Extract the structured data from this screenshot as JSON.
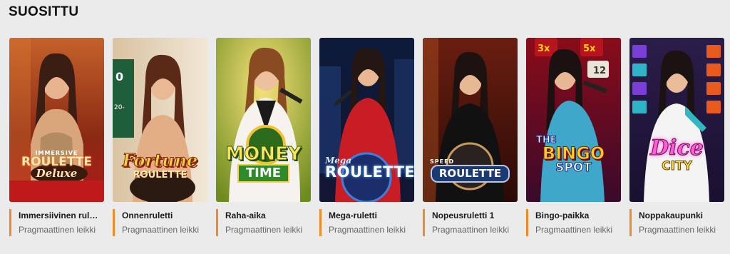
{
  "section": {
    "title": "SUOSITTU"
  },
  "games": [
    {
      "title": "Immersiivinen rul…",
      "provider": "Pragmaattinen leikki",
      "logo_lines": [
        "IMMERSIVE",
        "ROULETTE",
        "Deluxe"
      ]
    },
    {
      "title": "Onnenruletti",
      "provider": "Pragmaattinen leikki",
      "logo_lines": [
        "Fortune",
        "ROULETTE"
      ]
    },
    {
      "title": "Raha-aika",
      "provider": "Pragmaattinen leikki",
      "logo_lines": [
        "MONEY",
        "TIME"
      ]
    },
    {
      "title": "Mega-ruletti",
      "provider": "Pragmaattinen leikki",
      "logo_lines": [
        "Mega",
        "ROULETTE"
      ]
    },
    {
      "title": "Nopeusruletti 1",
      "provider": "Pragmaattinen leikki",
      "logo_lines": [
        "SPEED",
        "ROULETTE"
      ]
    },
    {
      "title": "Bingo-paikka",
      "provider": "Pragmaattinen leikki",
      "logo_lines": [
        "THE",
        "BINGO",
        "SPOT"
      ]
    },
    {
      "title": "Noppakaupunki",
      "provider": "Pragmaattinen leikki",
      "logo_lines": [
        "Dice",
        "CITY"
      ]
    }
  ],
  "colors": {
    "accent": "#f08a24",
    "background": "#ebebeb"
  }
}
